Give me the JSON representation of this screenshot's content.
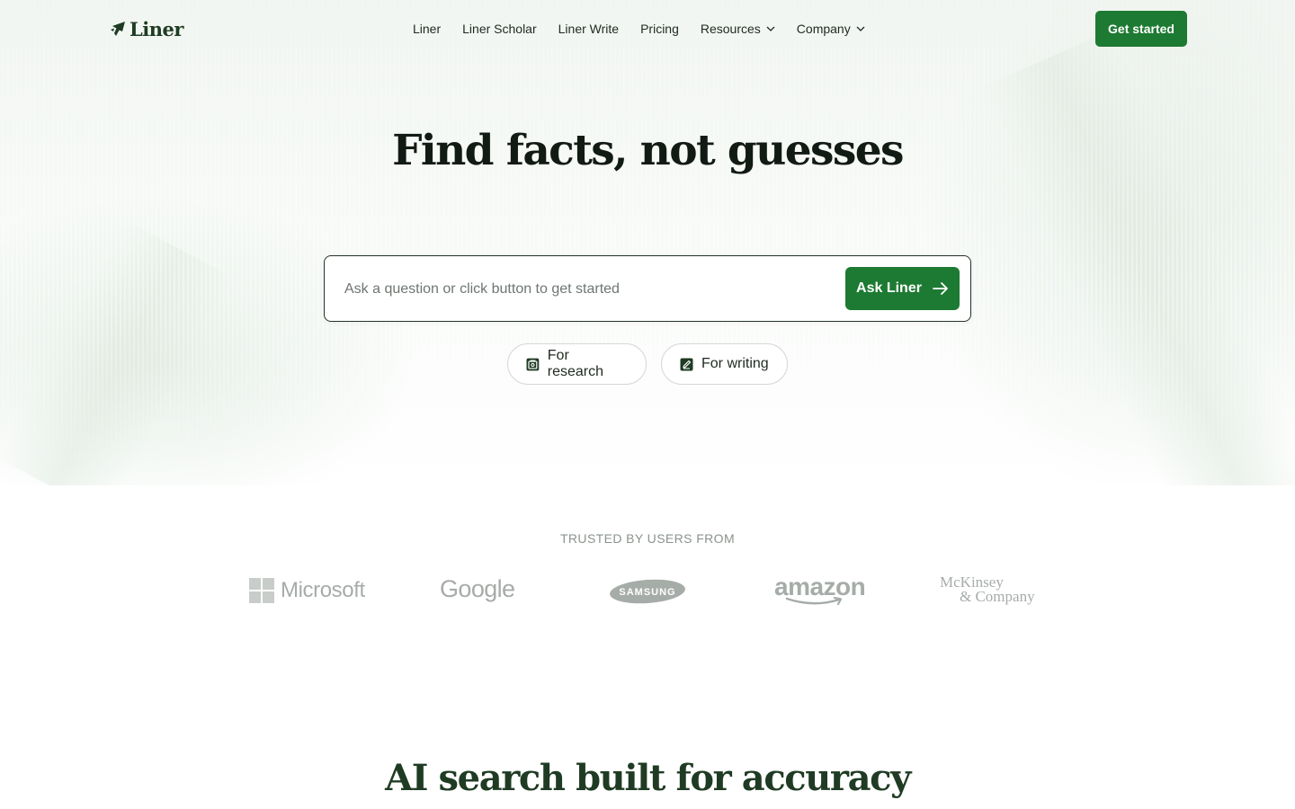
{
  "colors": {
    "brand_green": "#1d7a32",
    "dark_green": "#1f3b23",
    "logo_gray": "#a6aca8"
  },
  "header": {
    "logo_text": "Liner",
    "logo_icon": "liner-logo-icon",
    "nav": [
      {
        "label": "Liner"
      },
      {
        "label": "Liner Scholar"
      },
      {
        "label": "Liner Write"
      },
      {
        "label": "Pricing"
      },
      {
        "label": "Resources",
        "icon": "chevron-down-icon"
      },
      {
        "label": "Company",
        "icon": "chevron-down-icon"
      }
    ],
    "cta_label": "Get started"
  },
  "hero": {
    "title": "Find facts, not guesses",
    "search": {
      "placeholder": "Ask a question or click button to get started",
      "value": "",
      "button_label": "Ask Liner",
      "button_icon": "arrow-right-icon"
    },
    "chips": [
      {
        "label": "For research",
        "icon": "research-icon"
      },
      {
        "label": "For writing",
        "icon": "writing-icon"
      }
    ]
  },
  "trusted": {
    "label": "TRUSTED BY USERS FROM",
    "logos": [
      {
        "name": "Microsoft",
        "text": "Microsoft"
      },
      {
        "name": "Google",
        "text": "Google"
      },
      {
        "name": "Samsung",
        "text": "SAMSUNG"
      },
      {
        "name": "Amazon",
        "text": "amazon"
      },
      {
        "name": "McKinsey & Company",
        "text_line1": "McKinsey",
        "text_line2": "& Company"
      }
    ]
  },
  "section": {
    "title": "AI search built for accuracy"
  }
}
